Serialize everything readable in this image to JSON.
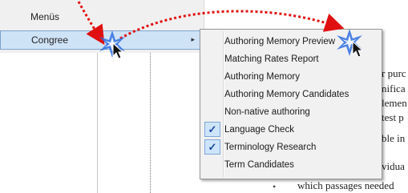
{
  "left_menu": {
    "items": [
      {
        "label": "Menüs"
      },
      {
        "label": "Congree",
        "submenu_indicator": "▸"
      }
    ]
  },
  "context_menu": {
    "items": [
      {
        "label": "Authoring Memory Preview",
        "checked": false
      },
      {
        "label": "Matching Rates Report",
        "checked": false
      },
      {
        "label": "Authoring Memory",
        "checked": false
      },
      {
        "label": "Authoring Memory Candidates",
        "checked": false
      },
      {
        "label": "Non-native authoring",
        "checked": false
      },
      {
        "label": "Language Check",
        "checked": true
      },
      {
        "label": "Terminology Research",
        "checked": true
      },
      {
        "label": "Term Candidates",
        "checked": false
      }
    ],
    "check_glyph": "✓"
  },
  "document_fragments": [
    "r purc",
    "nifica",
    "lemen",
    "test p",
    "ble in",
    "vidua",
    "which passages needed"
  ],
  "colors": {
    "highlight": "#cfe3f7",
    "arrow": "#e01010",
    "spark": "#2f6fe0"
  }
}
